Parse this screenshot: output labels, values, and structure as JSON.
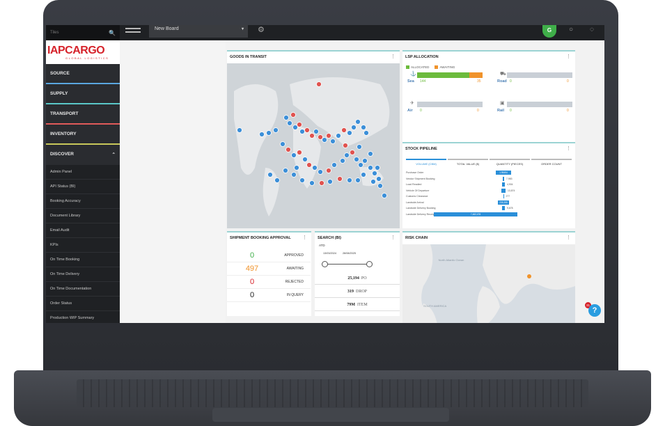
{
  "sidebar": {
    "search_placeholder": "Tiles",
    "logo_brand": "IAPCARGO",
    "logo_sub": "GLOBAL LOGISTICS",
    "sections": [
      {
        "label": "SOURCE"
      },
      {
        "label": "SUPPLY"
      },
      {
        "label": "TRANSPORT"
      },
      {
        "label": "INVENTORY"
      },
      {
        "label": "DISCOVER"
      }
    ],
    "discover_items": [
      "Admin Panel",
      "API Status (BI)",
      "Booking Accuracy",
      "Document Library",
      "Email Audit",
      "KPIs",
      "On Time Booking",
      "On Time Delivery",
      "On Time Documentation",
      "Order Status",
      "Production WIP Summary"
    ]
  },
  "topbar": {
    "board_name": "New Board",
    "avatar_initial": "G"
  },
  "goods_in_transit": {
    "title": "GOODS IN TRANSIT"
  },
  "lsp_allocation": {
    "title": "LSP ALLOCATION",
    "legend": [
      {
        "label": "ALLOCATED",
        "color": "#6cbb3c"
      },
      {
        "label": "AWAITING",
        "color": "#f0932b"
      }
    ],
    "modes": [
      {
        "name": "Sea",
        "allocated": "144",
        "awaiting": "35",
        "allocated_share": 0.8
      },
      {
        "name": "Road",
        "allocated": "0",
        "awaiting": "0",
        "allocated_share": 0
      },
      {
        "name": "Air",
        "allocated": "0",
        "awaiting": "0",
        "allocated_share": 0
      },
      {
        "name": "Rail",
        "allocated": "0",
        "awaiting": "0",
        "allocated_share": 0
      }
    ]
  },
  "stock_pipeline": {
    "title": "STOCK PIPELINE",
    "tabs": [
      "VOLUME (CBM)",
      "TOTAL VALUE ($)",
      "QUANTITY (PIECES)",
      "ORDER COUNT"
    ],
    "stages": [
      {
        "label": "Purchase Order",
        "value": "1.95494"
      },
      {
        "label": "Vendor Shipment Booking",
        "value": "7,983"
      },
      {
        "label": "Load Readied",
        "value": "4,904"
      },
      {
        "label": "Vehicle Of Departure",
        "value": "13,874"
      },
      {
        "label": "Customs Clearance",
        "value": "277"
      },
      {
        "label": "Landside Arrival",
        "value": "239,395"
      },
      {
        "label": "Landside Delivery Booking",
        "value": "9,678"
      },
      {
        "label": "Landside Delivery Receipt",
        "value": "7,482,478"
      }
    ]
  },
  "shipment_booking_approval": {
    "title": "SHIPMENT BOOKING APPROVAL",
    "rows": [
      {
        "value": "0",
        "label": "APPROVED",
        "color": "#3fae49"
      },
      {
        "value": "497",
        "label": "AWAITING",
        "color": "#f0932b"
      },
      {
        "value": "0",
        "label": "REJECTED",
        "color": "#d6222a"
      },
      {
        "value": "0",
        "label": "IN QUERY",
        "color": "#222222"
      }
    ]
  },
  "search_bi": {
    "title": "SEARCH (BI)",
    "field": "ATD",
    "date_from": "13/03/2024",
    "date_to": "28/08/2025",
    "stats": [
      {
        "value": "25,194",
        "unit": "PO"
      },
      {
        "value": "319",
        "unit": "DROP"
      },
      {
        "value": "79M",
        "unit": "ITEM"
      }
    ]
  },
  "risk_chain": {
    "title": "RISK CHAIN",
    "map_labels": [
      "North Atlantic Ocean",
      "SOUTH AMERICA"
    ]
  },
  "help": {
    "badge_count": "31",
    "icon": "?"
  }
}
